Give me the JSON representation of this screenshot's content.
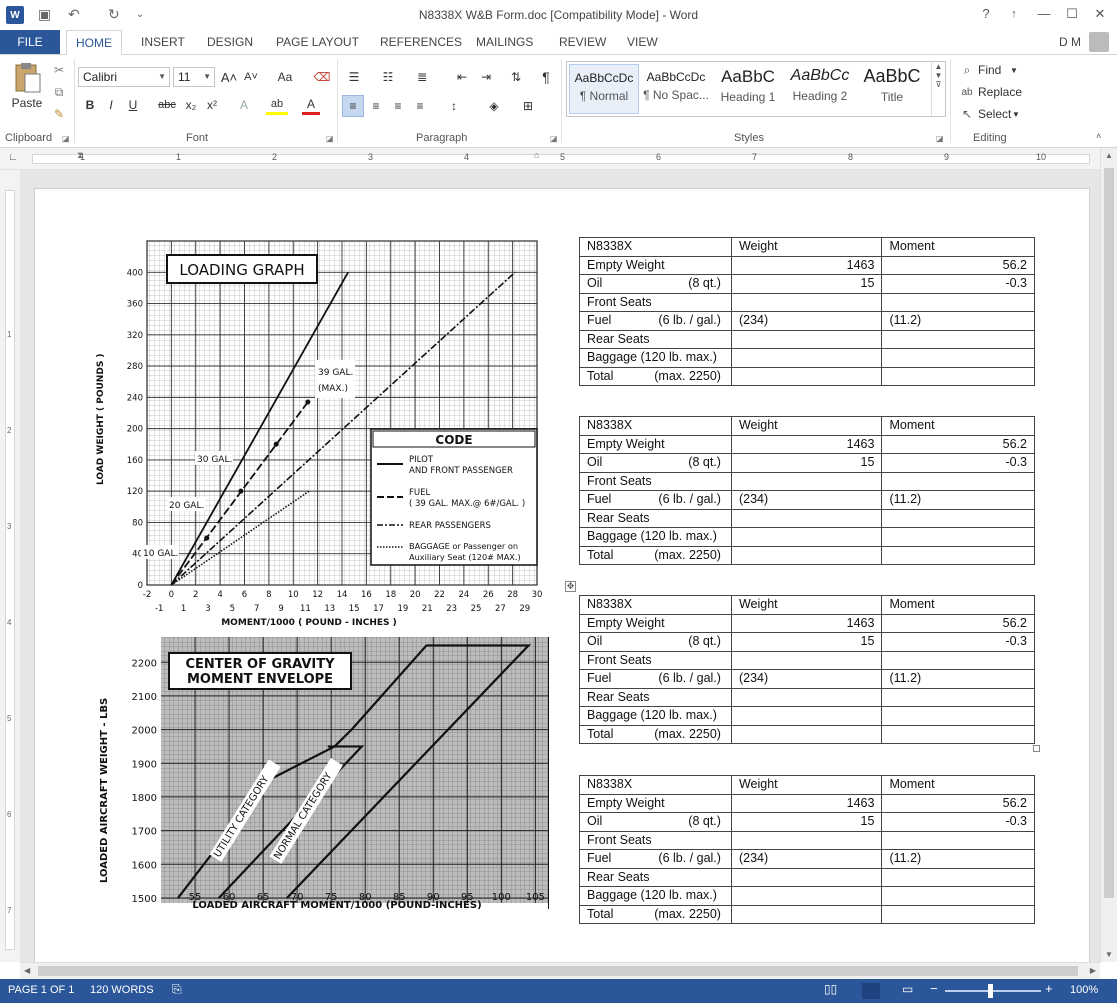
{
  "window": {
    "title": "N8338X W&B Form.doc [Compatibility Mode] - Word",
    "help": "?",
    "minimize": "—",
    "restore": "☐",
    "close": "✕",
    "ribbon_options": "↑"
  },
  "qat": {
    "app_icon": "W",
    "save": "💾",
    "undo": "↶",
    "redo": "↻",
    "customize": "⌄"
  },
  "tabs": {
    "file": "FILE",
    "items": [
      "HOME",
      "INSERT",
      "DESIGN",
      "PAGE LAYOUT",
      "REFERENCES",
      "MAILINGS",
      "REVIEW",
      "VIEW"
    ],
    "user": "D M"
  },
  "ribbon": {
    "clipboard": {
      "label": "Clipboard",
      "paste": "Paste"
    },
    "font": {
      "label": "Font",
      "family": "Calibri",
      "size": "11",
      "bold": "B",
      "italic": "I",
      "underline": "U",
      "strike": "abc",
      "subscript": "x₂",
      "superscript": "x²",
      "grow": "A˄",
      "shrink": "A˅",
      "case": "Aa",
      "effects": "A",
      "highlight": "ab",
      "color": "A"
    },
    "paragraph": {
      "label": "Paragraph",
      "pilcrow": "¶"
    },
    "styles": {
      "label": "Styles",
      "items": [
        {
          "sample": "AaBbCcDc",
          "name": "¶ Normal"
        },
        {
          "sample": "AaBbCcDc",
          "name": "¶ No Spac..."
        },
        {
          "sample": "AaBbC",
          "name": "Heading 1"
        },
        {
          "sample": "AaBbCc",
          "name": "Heading 2"
        },
        {
          "sample": "AaBbC",
          "name": "Title"
        }
      ]
    },
    "editing": {
      "label": "Editing",
      "find": "Find",
      "replace": "Replace",
      "select": "Select"
    }
  },
  "ruler": {
    "h_numbers": [
      "1",
      "1",
      "2",
      "3",
      "4",
      "5",
      "6",
      "7",
      "8",
      "9",
      "10"
    ],
    "v_numbers": [
      "1",
      "2",
      "3",
      "4",
      "5",
      "6",
      "7"
    ]
  },
  "wb_tables": [
    {
      "header": [
        "N8338X",
        "Weight",
        "Moment"
      ],
      "rows": [
        {
          "item": "Empty Weight",
          "sub": "",
          "weight": "1463",
          "moment": "56.2"
        },
        {
          "item": "Oil",
          "sub": "(8 qt.)",
          "weight": "15",
          "moment": "-0.3"
        },
        {
          "item": "Front Seats",
          "sub": "",
          "weight": "",
          "moment": ""
        },
        {
          "item": "Fuel",
          "sub": "(6 lb. / gal.)",
          "weight": "(234)",
          "moment": "(11.2)"
        },
        {
          "item": "Rear Seats",
          "sub": "",
          "weight": "",
          "moment": ""
        },
        {
          "item": "Baggage (120 lb. max.)",
          "sub": "",
          "weight": "",
          "moment": ""
        },
        {
          "item": "Total",
          "sub": "(max. 2250)",
          "weight": "",
          "moment": ""
        }
      ]
    },
    {
      "header": [
        "N8338X",
        "Weight",
        "Moment"
      ],
      "rows": [
        {
          "item": "Empty Weight",
          "sub": "",
          "weight": "1463",
          "moment": "56.2"
        },
        {
          "item": "Oil",
          "sub": "(8 qt.)",
          "weight": "15",
          "moment": "-0.3"
        },
        {
          "item": "Front Seats",
          "sub": "",
          "weight": "",
          "moment": ""
        },
        {
          "item": "Fuel",
          "sub": "(6 lb. / gal.)",
          "weight": "(234)",
          "moment": "(11.2)"
        },
        {
          "item": "Rear Seats",
          "sub": "",
          "weight": "",
          "moment": ""
        },
        {
          "item": "Baggage (120 lb. max.)",
          "sub": "",
          "weight": "",
          "moment": ""
        },
        {
          "item": "Total",
          "sub": "(max. 2250)",
          "weight": "",
          "moment": ""
        }
      ]
    },
    {
      "header": [
        "N8338X",
        "Weight",
        "Moment"
      ],
      "rows": [
        {
          "item": "Empty Weight",
          "sub": "",
          "weight": "1463",
          "moment": "56.2"
        },
        {
          "item": "Oil",
          "sub": "(8 qt.)",
          "weight": "15",
          "moment": "-0.3"
        },
        {
          "item": "Front Seats",
          "sub": "",
          "weight": "",
          "moment": ""
        },
        {
          "item": "Fuel",
          "sub": "(6 lb. / gal.)",
          "weight": "(234)",
          "moment": "(11.2)"
        },
        {
          "item": "Rear Seats",
          "sub": "",
          "weight": "",
          "moment": ""
        },
        {
          "item": "Baggage (120 lb. max.)",
          "sub": "",
          "weight": "",
          "moment": ""
        },
        {
          "item": "Total",
          "sub": "(max. 2250)",
          "weight": "",
          "moment": ""
        }
      ]
    },
    {
      "header": [
        "N8338X",
        "Weight",
        "Moment"
      ],
      "rows": [
        {
          "item": "Empty Weight",
          "sub": "",
          "weight": "1463",
          "moment": "56.2"
        },
        {
          "item": "Oil",
          "sub": "(8 qt.)",
          "weight": "15",
          "moment": "-0.3"
        },
        {
          "item": "Front Seats",
          "sub": "",
          "weight": "",
          "moment": ""
        },
        {
          "item": "Fuel",
          "sub": "(6 lb. / gal.)",
          "weight": "(234)",
          "moment": "(11.2)"
        },
        {
          "item": "Rear Seats",
          "sub": "",
          "weight": "",
          "moment": ""
        },
        {
          "item": "Baggage (120 lb. max.)",
          "sub": "",
          "weight": "",
          "moment": ""
        },
        {
          "item": "Total",
          "sub": "(max. 2250)",
          "weight": "",
          "moment": ""
        }
      ]
    }
  ],
  "loading_graph": {
    "title": "LOADING GRAPH",
    "ylabel": "LOAD WEIGHT ( POUNDS )",
    "xlabel": "MOMENT/1000 ( POUND - INCHES )",
    "y_ticks": [
      "400",
      "360",
      "320",
      "280",
      "240",
      "200",
      "160",
      "120",
      "80",
      "40",
      "0"
    ],
    "x_ticks_top": [
      "-2",
      "0",
      "2",
      "4",
      "6",
      "8",
      "10",
      "12",
      "14",
      "16",
      "18",
      "20",
      "22",
      "24",
      "26",
      "28",
      "30"
    ],
    "x_ticks_bottom": [
      "-1",
      "1",
      "3",
      "5",
      "7",
      "9",
      "11",
      "13",
      "15",
      "17",
      "19",
      "21",
      "23",
      "25",
      "27",
      "29"
    ],
    "fuel_labels": [
      "39 GAL.",
      "(MAX.)",
      "30 GAL.",
      "20 GAL.",
      "10 GAL."
    ],
    "code_title": "CODE",
    "code_items": [
      {
        "line1": "PILOT",
        "line2": "AND FRONT PASSENGER"
      },
      {
        "line1": "FUEL",
        "line2": "( 39 GAL. MAX.@ 6#/GAL. )"
      },
      {
        "line1": "REAR PASSENGERS",
        "line2": ""
      },
      {
        "line1": "BAGGAGE or Passenger on",
        "line2": "Auxiliary Seat (120# MAX.)"
      }
    ]
  },
  "cg_envelope": {
    "title_line1": "CENTER OF GRAVITY",
    "title_line2": "MOMENT ENVELOPE",
    "ylabel": "LOADED AIRCRAFT WEIGHT - LBS",
    "xlabel": "LOADED AIRCRAFT MOMENT/1000 (POUND-INCHES)",
    "y_ticks": [
      "2200",
      "2100",
      "2000",
      "1900",
      "1800",
      "1700",
      "1600",
      "1500"
    ],
    "x_ticks": [
      "55",
      "60",
      "65",
      "70",
      "75",
      "80",
      "85",
      "90",
      "95",
      "100",
      "105"
    ],
    "utility_label": "UTILITY CATEGORY",
    "normal_label": "NORMAL CATEGORY"
  },
  "status": {
    "page": "PAGE 1 OF 1",
    "words": "120 WORDS",
    "zoom": "100%"
  }
}
